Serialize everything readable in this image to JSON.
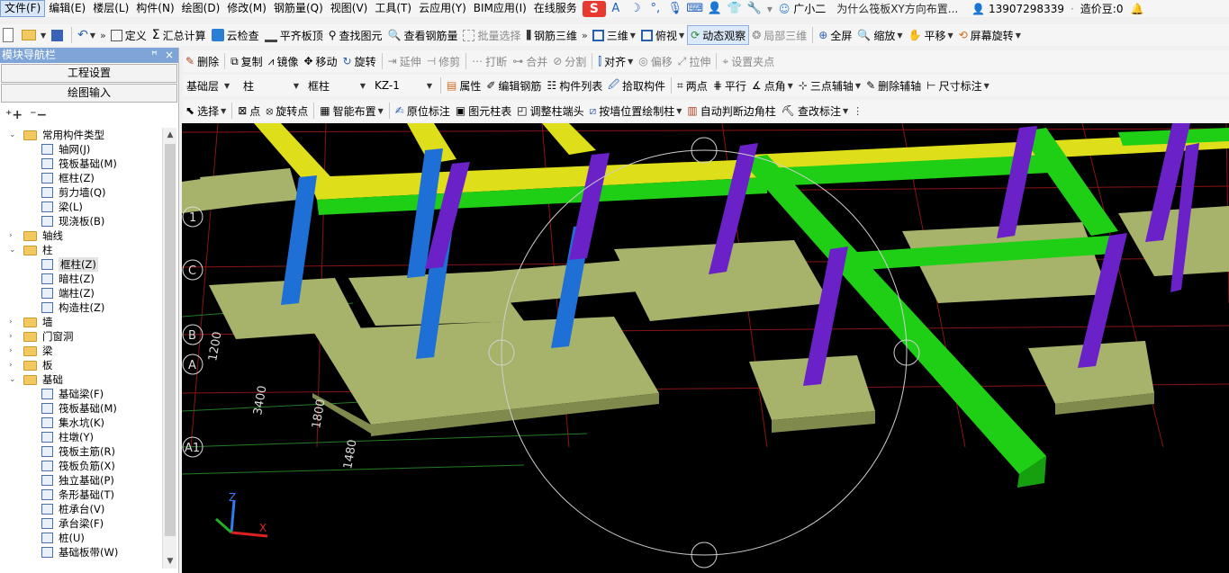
{
  "menu": {
    "file": "文件(F)",
    "edit": "编辑(E)",
    "floor": "楼层(L)",
    "component": "构件(N)",
    "draw": "绘图(D)",
    "modify": "修改(M)",
    "rebar_qty": "钢筋量(Q)",
    "view": "视图(V)",
    "tools": "工具(T)",
    "cloud": "云应用(Y)",
    "bim": "BIM应用(I)",
    "online": "在线服务",
    "helper": "广小二",
    "question": "为什么筏板XY方向布置...",
    "phone": "13907298339",
    "bean": "造价豆:0"
  },
  "toolbar1": {
    "define": "定义",
    "sum_calc": "汇总计算",
    "cloud_check": "云检查",
    "flat_top": "平齐板顶",
    "find_element": "查找图元",
    "view_rebar_qty": "查看钢筋量",
    "batch_select": "批量选择",
    "rebar_3d": "钢筋三维",
    "three_d": "三维",
    "top_view": "俯视",
    "dynamic_observe": "动态观察",
    "local_3d": "局部三维",
    "full_screen": "全屏",
    "zoom": "缩放",
    "pan": "平移",
    "screen_rotate": "屏幕旋转"
  },
  "nav": {
    "title": "模块导航栏",
    "pin": "ꟸ",
    "close": "×",
    "project_settings": "工程设置",
    "drawing_input": "绘图输入",
    "tree": [
      {
        "label": "常用构件类型",
        "level": 0,
        "type": "folder",
        "toggle": "⌄"
      },
      {
        "label": "轴网(J)",
        "level": 1,
        "type": "comp"
      },
      {
        "label": "筏板基础(M)",
        "level": 1,
        "type": "comp"
      },
      {
        "label": "框柱(Z)",
        "level": 1,
        "type": "comp"
      },
      {
        "label": "剪力墙(Q)",
        "level": 1,
        "type": "comp"
      },
      {
        "label": "梁(L)",
        "level": 1,
        "type": "comp"
      },
      {
        "label": "现浇板(B)",
        "level": 1,
        "type": "comp"
      },
      {
        "label": "轴线",
        "level": 0,
        "type": "folder",
        "toggle": "›"
      },
      {
        "label": "柱",
        "level": 0,
        "type": "folder",
        "toggle": "⌄"
      },
      {
        "label": "框柱(Z)",
        "level": 1,
        "type": "comp",
        "selected": true
      },
      {
        "label": "暗柱(Z)",
        "level": 1,
        "type": "comp"
      },
      {
        "label": "端柱(Z)",
        "level": 1,
        "type": "comp"
      },
      {
        "label": "构造柱(Z)",
        "level": 1,
        "type": "comp"
      },
      {
        "label": "墙",
        "level": 0,
        "type": "folder",
        "toggle": "›"
      },
      {
        "label": "门窗洞",
        "level": 0,
        "type": "folder",
        "toggle": "›"
      },
      {
        "label": "梁",
        "level": 0,
        "type": "folder",
        "toggle": "›"
      },
      {
        "label": "板",
        "level": 0,
        "type": "folder",
        "toggle": "›"
      },
      {
        "label": "基础",
        "level": 0,
        "type": "folder",
        "toggle": "⌄"
      },
      {
        "label": "基础梁(F)",
        "level": 1,
        "type": "comp"
      },
      {
        "label": "筏板基础(M)",
        "level": 1,
        "type": "comp"
      },
      {
        "label": "集水坑(K)",
        "level": 1,
        "type": "comp"
      },
      {
        "label": "柱墩(Y)",
        "level": 1,
        "type": "comp"
      },
      {
        "label": "筏板主筋(R)",
        "level": 1,
        "type": "comp"
      },
      {
        "label": "筏板负筋(X)",
        "level": 1,
        "type": "comp"
      },
      {
        "label": "独立基础(P)",
        "level": 1,
        "type": "comp"
      },
      {
        "label": "条形基础(T)",
        "level": 1,
        "type": "comp"
      },
      {
        "label": "桩承台(V)",
        "level": 1,
        "type": "comp"
      },
      {
        "label": "承台梁(F)",
        "level": 1,
        "type": "comp"
      },
      {
        "label": "桩(U)",
        "level": 1,
        "type": "comp"
      },
      {
        "label": "基础板带(W)",
        "level": 1,
        "type": "comp"
      }
    ]
  },
  "toolbar2": {
    "delete": "删除",
    "copy": "复制",
    "mirror": "镜像",
    "move": "移动",
    "rotate": "旋转",
    "extend": "延伸",
    "trim": "修剪",
    "break": "打断",
    "merge": "合并",
    "split": "分割",
    "align": "对齐",
    "offset": "偏移",
    "stretch": "拉伸",
    "set_grip": "设置夹点"
  },
  "toolbar3": {
    "layer": "基础层",
    "category": "柱",
    "type": "框柱",
    "name": "KZ-1",
    "properties": "属性",
    "edit_rebar": "编辑钢筋",
    "component_list": "构件列表",
    "pick_component": "拾取构件",
    "two_points": "两点",
    "parallel": "平行",
    "point_angle": "点角",
    "three_point_aux": "三点辅轴",
    "delete_aux": "删除辅轴",
    "dimension": "尺寸标注"
  },
  "toolbar4": {
    "select": "选择",
    "point": "点",
    "rotate_point": "旋转点",
    "smart_layout": "智能布置",
    "origin_mark": "原位标注",
    "element_table": "图元柱表",
    "adjust_column_end": "调整柱端头",
    "wall_position_column": "按墙位置绘制柱",
    "auto_corner_column": "自动判断边角柱",
    "change_mark": "查改标注"
  },
  "viewport": {
    "axis_labels": [
      "1",
      "C",
      "B",
      "A",
      "A1"
    ],
    "dimensions": [
      "1200",
      "3400",
      "1800",
      "1480"
    ],
    "coord_axes": {
      "z": "Z",
      "x": "X"
    },
    "colors": {
      "background": "#000000",
      "footing": "#a7b36b",
      "column_blue": "#1e6fd6",
      "column_purple": "#6a22c8",
      "beam_yellow": "#dede1a",
      "beam_green": "#1fcf16",
      "grid_red": "#a01616",
      "grid_green": "#2a8a2a"
    }
  }
}
